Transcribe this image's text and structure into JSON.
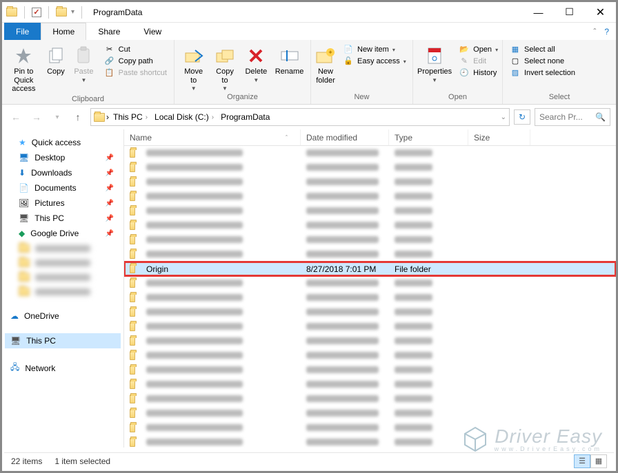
{
  "title": "ProgramData",
  "tabs": {
    "file": "File",
    "home": "Home",
    "share": "Share",
    "view": "View"
  },
  "ribbon": {
    "clipboard": {
      "label": "Clipboard",
      "pin": "Pin to Quick\naccess",
      "copy": "Copy",
      "paste": "Paste",
      "cut": "Cut",
      "copypath": "Copy path",
      "shortcut": "Paste shortcut"
    },
    "organize": {
      "label": "Organize",
      "moveto": "Move\nto",
      "copyto": "Copy\nto",
      "delete": "Delete",
      "rename": "Rename"
    },
    "new": {
      "label": "New",
      "newfolder": "New\nfolder",
      "newitem": "New item",
      "easyaccess": "Easy access"
    },
    "open": {
      "label": "Open",
      "properties": "Properties",
      "open": "Open",
      "edit": "Edit",
      "history": "History"
    },
    "select": {
      "label": "Select",
      "all": "Select all",
      "none": "Select none",
      "invert": "Invert selection"
    }
  },
  "breadcrumb": [
    "This PC",
    "Local Disk (C:)",
    "ProgramData"
  ],
  "search_placeholder": "Search Pr...",
  "nav": {
    "quick": "Quick access",
    "desktop": "Desktop",
    "downloads": "Downloads",
    "documents": "Documents",
    "pictures": "Pictures",
    "thispc": "This PC",
    "gdrive": "Google Drive",
    "onedrive": "OneDrive",
    "thispc2": "This PC",
    "network": "Network"
  },
  "columns": {
    "name": "Name",
    "date": "Date modified",
    "type": "Type",
    "size": "Size"
  },
  "selected_row": {
    "name": "Origin",
    "date": "8/27/2018 7:01 PM",
    "type": "File folder"
  },
  "blurred_row_count_before": 8,
  "blurred_row_count_after": 12,
  "status": {
    "count": "22 items",
    "selected": "1 item selected"
  },
  "watermark": {
    "brand": "Driver Easy",
    "url": "www.DriverEasy.com"
  }
}
